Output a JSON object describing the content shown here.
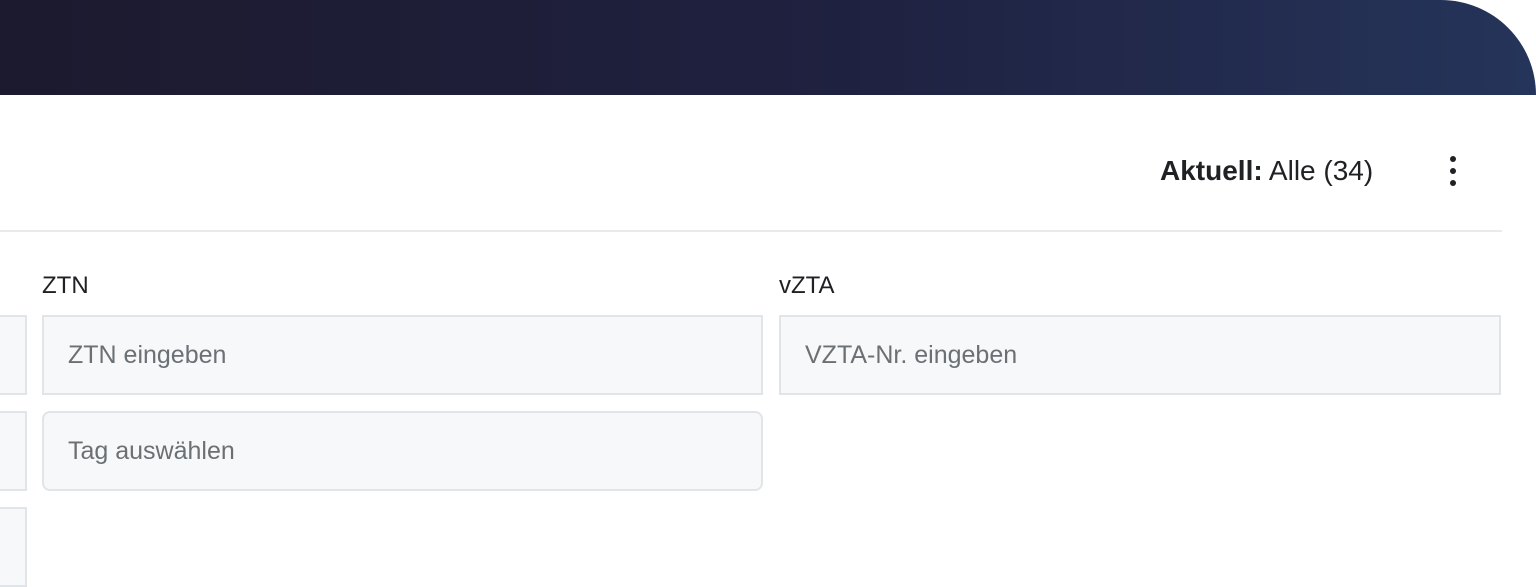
{
  "header": {
    "status_label": "Aktuell:",
    "status_value": " Alle (34)",
    "more_menu_icon": "kebab-vertical"
  },
  "filters": {
    "ztn": {
      "label": "ZTN",
      "placeholder": "ZTN eingeben"
    },
    "vzta": {
      "label": "vZTA",
      "placeholder": "VZTA-Nr. eingeben"
    },
    "tag": {
      "placeholder": "Tag auswählen"
    }
  },
  "colors": {
    "header_bg": "#1f2140",
    "input_bg": "#f7f8f9",
    "input_border": "#e1e4e8",
    "text": "#202124",
    "placeholder": "#6b7075"
  }
}
